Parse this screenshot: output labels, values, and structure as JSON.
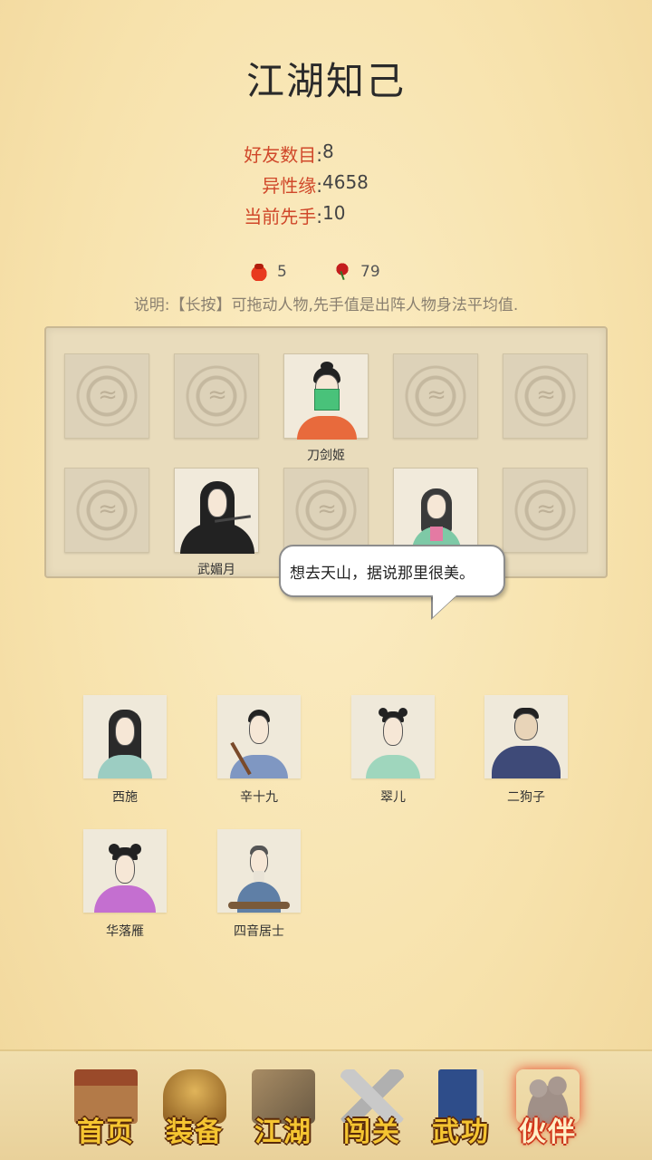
{
  "title": "江湖知己",
  "stats": [
    {
      "label": "好友数目",
      "value": "8"
    },
    {
      "label": "异性缘",
      "value": "4658"
    },
    {
      "label": "当前先手",
      "value": "10"
    }
  ],
  "resources": [
    {
      "icon": "money-pouch-icon",
      "value": "5"
    },
    {
      "icon": "rose-icon",
      "value": "79"
    }
  ],
  "note": "说明:【长按】可拖动人物,先手值是出阵人物身法平均值.",
  "lineup": {
    "slots": [
      {
        "filled": false,
        "name": ""
      },
      {
        "filled": false,
        "name": ""
      },
      {
        "filled": true,
        "name": "刀剑姬"
      },
      {
        "filled": false,
        "name": ""
      },
      {
        "filled": false,
        "name": ""
      },
      {
        "filled": false,
        "name": ""
      },
      {
        "filled": true,
        "name": "武媚月"
      },
      {
        "filled": false,
        "name": ""
      },
      {
        "filled": true,
        "name": ""
      },
      {
        "filled": false,
        "name": ""
      }
    ]
  },
  "speech_bubble": "想去天山，据说那里很美。",
  "reserve": [
    {
      "name": "西施"
    },
    {
      "name": "辛十九"
    },
    {
      "name": "翠儿"
    },
    {
      "name": "二狗子"
    },
    {
      "name": "华落雁"
    },
    {
      "name": "四音居士"
    }
  ],
  "nav": [
    {
      "label": "首页",
      "icon": "house-icon",
      "active": false
    },
    {
      "label": "装备",
      "icon": "armor-icon",
      "active": false
    },
    {
      "label": "江湖",
      "icon": "scroll-map-icon",
      "active": false
    },
    {
      "label": "闯关",
      "icon": "crossed-swords-icon",
      "active": false
    },
    {
      "label": "武功",
      "icon": "book-icon",
      "active": false
    },
    {
      "label": "伙伴",
      "icon": "companions-icon",
      "active": true
    }
  ],
  "colors": {
    "accent_red": "#d0482a",
    "background": "#f8e6b3",
    "nav_label": "#f5c531"
  }
}
